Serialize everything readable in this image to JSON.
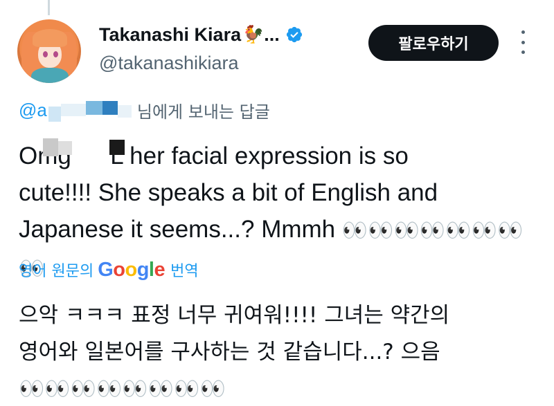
{
  "author": {
    "display_name": "Takanashi Kiara",
    "name_emoji": "🐓",
    "truncation": "...",
    "handle": "@takanashikiara",
    "verified_color": "#1d9bf0"
  },
  "follow_button": {
    "label": "팔로우하기"
  },
  "reply_context": {
    "at_sign": "@",
    "user_visible": "a",
    "suffix": "님에게 보내는 답글"
  },
  "tweet": {
    "line1": "Omg LOL her facial expression is so",
    "line2": "cute!!!! She speaks a bit of English and",
    "line3_text": "Japanese it seems...? Mmmh ",
    "line3_emoji": "👀👀👀👀👀👀👀👀"
  },
  "translation_bar": {
    "prefix": "영어 원문의",
    "brand": "Google",
    "action": "번역"
  },
  "translated": {
    "line1": "으악 ㅋㅋㅋ 표정 너무 귀여워!!!! 그녀는 약간의",
    "line2": "영어와 일본어를 구사하는 것 같습니다...? 으음",
    "line3_emoji": "👀👀👀👀👀👀👀👀"
  },
  "colors": {
    "link_blue": "#1d9bf0",
    "text_primary": "#0f1419",
    "text_secondary": "#536471",
    "button_bg": "#0f1419"
  }
}
